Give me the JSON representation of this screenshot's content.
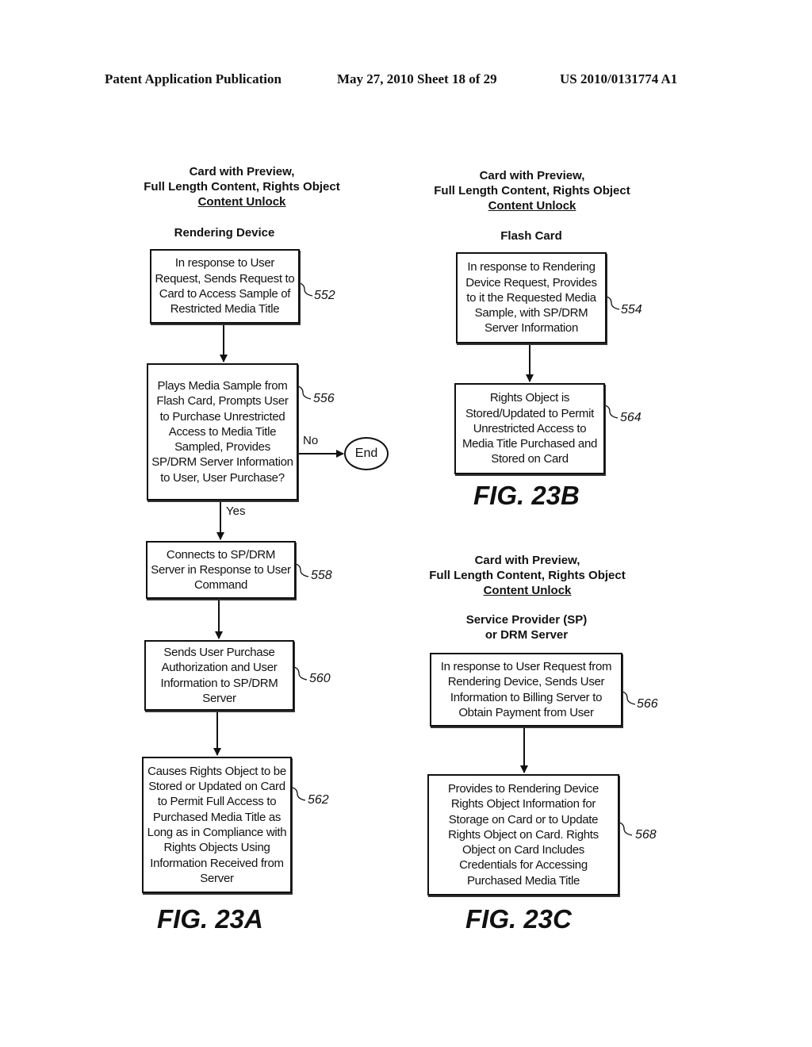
{
  "header": {
    "publication": "Patent Application Publication",
    "date_sheet": "May 27, 2010  Sheet 18 of 29",
    "number": "US 2010/0131774 A1"
  },
  "figures": {
    "a": {
      "title_line1": "Card with Preview,",
      "title_line2": "Full Length Content, Rights Object",
      "title_line3": "Content Unlock",
      "actor": "Rendering Device",
      "caption": "FIG. 23A",
      "steps": [
        {
          "ref": "552",
          "text": "In response to User Request, Sends Request to Card to Access Sample of Restricted Media Title"
        },
        {
          "ref": "556",
          "text": "Plays Media Sample from Flash Card, Prompts User to Purchase Unrestricted Access to Media Title Sampled, Provides SP/DRM Server Information to User, User Purchase?"
        },
        {
          "ref": "558",
          "text": "Connects to SP/DRM Server in Response to User Command"
        },
        {
          "ref": "560",
          "text": "Sends User Purchase Authorization and User Information to SP/DRM Server"
        },
        {
          "ref": "562",
          "text": "Causes Rights Object to be Stored or Updated on Card to Permit Full Access to Purchased Media Title as Long as in Compliance with Rights Objects Using Information Received from Server"
        }
      ],
      "no_label": "No",
      "yes_label": "Yes",
      "end_label": "End"
    },
    "b": {
      "title_line1": "Card with Preview,",
      "title_line2": "Full Length Content, Rights Object",
      "title_line3": "Content Unlock",
      "actor": "Flash Card",
      "caption": "FIG. 23B",
      "steps": [
        {
          "ref": "554",
          "text": "In response to Rendering Device Request, Provides to it the Requested Media Sample, with SP/DRM Server Information"
        },
        {
          "ref": "564",
          "text": "Rights Object is Stored/Updated to Permit Unrestricted Access to Media Title Purchased and Stored on Card"
        }
      ]
    },
    "c": {
      "title_line1": "Card with Preview,",
      "title_line2": "Full Length Content, Rights Object",
      "title_line3": "Content Unlock",
      "actor_line1": "Service Provider (SP)",
      "actor_line2": "or DRM Server",
      "caption": "FIG. 23C",
      "steps": [
        {
          "ref": "566",
          "text": "In response to User Request from Rendering Device, Sends User Information to Billing Server to Obtain Payment from User"
        },
        {
          "ref": "568",
          "text": "Provides to Rendering Device Rights Object Information for Storage on Card or to Update Rights Object on Card.  Rights Object on Card Includes Credentials for Accessing Purchased Media Title"
        }
      ]
    }
  }
}
